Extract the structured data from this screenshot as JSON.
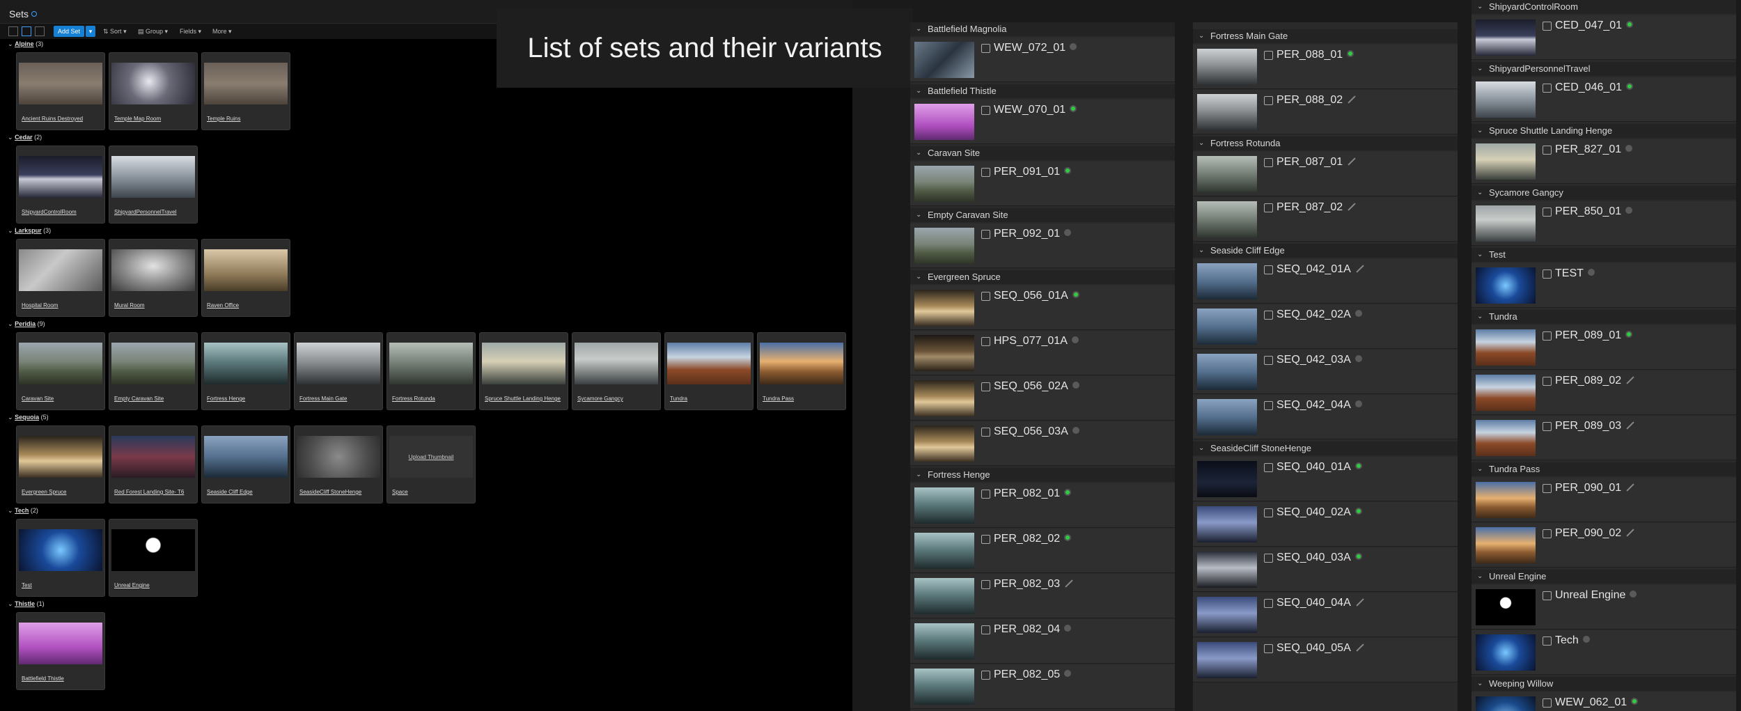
{
  "left_panel": {
    "title": "Sets",
    "toolbar": {
      "add_set": "Add Set",
      "add_set_dropdown": "▾",
      "sort": "Sort",
      "group": "Group",
      "fields": "Fields",
      "more": "More"
    },
    "groups": [
      {
        "name": "Alpine",
        "count": "(3)",
        "cards": [
          {
            "label": "Ancient Ruins Destroyed",
            "thumb": "ruins"
          },
          {
            "label": "Temple Map Room",
            "thumb": "temple_light"
          },
          {
            "label": "Temple Ruins",
            "thumb": "ruins"
          }
        ]
      },
      {
        "name": "Cedar",
        "count": "(2)",
        "cards": [
          {
            "label": "ShipyardControlRoom",
            "thumb": "shipyard"
          },
          {
            "label": "ShipyardPersonnelTravel",
            "thumb": "shipyard_light"
          }
        ]
      },
      {
        "name": "Larkspur",
        "count": "(3)",
        "cards": [
          {
            "label": "Hospital Room",
            "thumb": "interior"
          },
          {
            "label": "Mural Room",
            "thumb": "interior_grey"
          },
          {
            "label": "Raven Office",
            "thumb": "interior_warm"
          }
        ]
      },
      {
        "name": "Peridia",
        "count": "(9)",
        "cards": [
          {
            "label": "Caravan Site",
            "thumb": "landscape"
          },
          {
            "label": "Empty Caravan Site",
            "thumb": "landscape"
          },
          {
            "label": "Fortress Henge",
            "thumb": "henge"
          },
          {
            "label": "Fortress Main Gate",
            "thumb": "gate"
          },
          {
            "label": "Fortress Rotunda",
            "thumb": "rotunda"
          },
          {
            "label": "Spruce Shuttle Landing Henge",
            "thumb": "spruce"
          },
          {
            "label": "Sycamore Gangcy",
            "thumb": "gangcy"
          },
          {
            "label": "Tundra",
            "thumb": "tundra"
          },
          {
            "label": "Tundra Pass",
            "thumb": "tundra_pass"
          }
        ]
      },
      {
        "name": "Sequoia",
        "count": "(5)",
        "cards": [
          {
            "label": "Evergreen Spruce",
            "thumb": "evergreen"
          },
          {
            "label": "Red Forest Landing Site- T6",
            "thumb": "redforest"
          },
          {
            "label": "Seaside Cliff Edge",
            "thumb": "cliff"
          },
          {
            "label": "SeasideCliff StoneHenge",
            "thumb": "stones"
          },
          {
            "label": "Space",
            "thumb": "space",
            "upload": "Upload Thumbnail"
          }
        ]
      },
      {
        "name": "Tech",
        "count": "(2)",
        "cards": [
          {
            "label": "Test",
            "thumb": "tech"
          },
          {
            "label": "Unreal Engine",
            "thumb": "unreal"
          }
        ]
      },
      {
        "name": "Thistle",
        "count": "(1)",
        "cards": [
          {
            "label": "Battlefield Thistle",
            "thumb": "pink"
          }
        ]
      }
    ]
  },
  "caption": "List of sets and their variants",
  "columns": [
    [
      {
        "section": "Battlefield Magnolia",
        "variants": [
          {
            "name": "WEW_072_01",
            "status": "grey",
            "thumb": "magnolia"
          }
        ]
      },
      {
        "section": "Battlefield Thistle",
        "variants": [
          {
            "name": "WEW_070_01",
            "status": "green",
            "thumb": "pink"
          }
        ]
      },
      {
        "section": "Caravan Site",
        "variants": [
          {
            "name": "PER_091_01",
            "status": "green",
            "thumb": "landscape"
          }
        ]
      },
      {
        "section": "Empty Caravan Site",
        "variants": [
          {
            "name": "PER_092_01",
            "status": "grey",
            "thumb": "landscape"
          }
        ]
      },
      {
        "section": "Evergreen Spruce",
        "variants": [
          {
            "name": "SEQ_056_01A",
            "status": "green",
            "thumb": "evergreen"
          },
          {
            "name": "HPS_077_01A",
            "status": "grey",
            "thumb": "evergreen_dark"
          },
          {
            "name": "SEQ_056_02A",
            "status": "grey",
            "thumb": "evergreen"
          },
          {
            "name": "SEQ_056_03A",
            "status": "grey",
            "thumb": "evergreen"
          }
        ]
      },
      {
        "section": "Fortress Henge",
        "variants": [
          {
            "name": "PER_082_01",
            "status": "green",
            "thumb": "henge"
          },
          {
            "name": "PER_082_02",
            "status": "green",
            "thumb": "henge"
          },
          {
            "name": "PER_082_03",
            "status": "key",
            "thumb": "henge"
          },
          {
            "name": "PER_082_04",
            "status": "grey",
            "thumb": "henge"
          },
          {
            "name": "PER_082_05",
            "status": "grey",
            "thumb": "henge"
          }
        ]
      }
    ],
    [
      {
        "section": "Fortress Main Gate",
        "variants": [
          {
            "name": "PER_088_01",
            "status": "green",
            "thumb": "gate"
          },
          {
            "name": "PER_088_02",
            "status": "key",
            "thumb": "gate"
          }
        ]
      },
      {
        "section": "Fortress Rotunda",
        "variants": [
          {
            "name": "PER_087_01",
            "status": "key",
            "thumb": "rotunda"
          },
          {
            "name": "PER_087_02",
            "status": "key",
            "thumb": "rotunda"
          }
        ]
      },
      {
        "section": "Seaside Cliff Edge",
        "variants": [
          {
            "name": "SEQ_042_01A",
            "status": "key",
            "thumb": "cliff"
          },
          {
            "name": "SEQ_042_02A",
            "status": "grey",
            "thumb": "cliff"
          },
          {
            "name": "SEQ_042_03A",
            "status": "grey",
            "thumb": "cliff"
          },
          {
            "name": "SEQ_042_04A",
            "status": "grey",
            "thumb": "cliff"
          }
        ]
      },
      {
        "section": "SeasideCliff StoneHenge",
        "variants": [
          {
            "name": "SEQ_040_01A",
            "status": "green",
            "thumb": "night"
          },
          {
            "name": "SEQ_040_02A",
            "status": "green",
            "thumb": "stones_blue"
          },
          {
            "name": "SEQ_040_03A",
            "status": "green",
            "thumb": "stones_dusk"
          },
          {
            "name": "SEQ_040_04A",
            "status": "key",
            "thumb": "stones_blue"
          },
          {
            "name": "SEQ_040_05A",
            "status": "key",
            "thumb": "stones_blue"
          }
        ]
      }
    ],
    [
      {
        "section": "ShipyardControlRoom",
        "variants": [
          {
            "name": "CED_047_01",
            "status": "green",
            "thumb": "shipyard"
          }
        ]
      },
      {
        "section": "ShipyardPersonnelTravel",
        "variants": [
          {
            "name": "CED_046_01",
            "status": "green",
            "thumb": "shipyard_light"
          }
        ]
      },
      {
        "section": "Spruce Shuttle Landing Henge",
        "variants": [
          {
            "name": "PER_827_01",
            "status": "grey",
            "thumb": "spruce"
          }
        ]
      },
      {
        "section": "Sycamore Gangcy",
        "variants": [
          {
            "name": "PER_850_01",
            "status": "grey",
            "thumb": "gangcy"
          }
        ]
      },
      {
        "section": "Test",
        "variants": [
          {
            "name": "TEST",
            "status": "grey",
            "thumb": "tech"
          }
        ]
      },
      {
        "section": "Tundra",
        "variants": [
          {
            "name": "PER_089_01",
            "status": "green",
            "thumb": "tundra"
          },
          {
            "name": "PER_089_02",
            "status": "key",
            "thumb": "tundra"
          },
          {
            "name": "PER_089_03",
            "status": "key",
            "thumb": "tundra"
          }
        ]
      },
      {
        "section": "Tundra Pass",
        "variants": [
          {
            "name": "PER_090_01",
            "status": "key",
            "thumb": "tundra_pass"
          },
          {
            "name": "PER_090_02",
            "status": "key",
            "thumb": "tundra_pass"
          }
        ]
      },
      {
        "section": "Unreal Engine",
        "variants": [
          {
            "name": "Unreal Engine",
            "status": "grey",
            "thumb": "unreal"
          },
          {
            "name": "Tech",
            "status": "grey",
            "thumb": "tech"
          }
        ]
      },
      {
        "section": "Weeping Willow",
        "variants": [
          {
            "name": "WEW_062_01",
            "status": "green",
            "thumb": "willow"
          }
        ]
      }
    ]
  ],
  "colors": {
    "accent": "#1680d4",
    "status_green": "#2ecc40",
    "status_grey": "#5a5a5a"
  }
}
